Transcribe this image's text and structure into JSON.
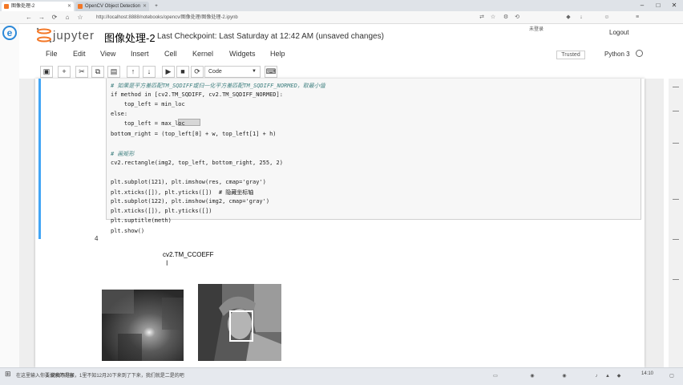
{
  "browser": {
    "tabs": [
      {
        "label": "图像处理-2",
        "active": true
      },
      {
        "label": "OpenCV Object Detection",
        "active": false
      }
    ],
    "url": "http://localhost:8888/notebooks/opencv/图像处理/图像处理-2.ipynb",
    "profile_label": "未登录"
  },
  "jupyter": {
    "logo_text": "jupyter",
    "notebook_title": "图像处理-2",
    "checkpoint": "Last Checkpoint: Last Saturday at 12:42 AM (unsaved changes)",
    "logout": "Logout",
    "menus": [
      "File",
      "Edit",
      "View",
      "Insert",
      "Cell",
      "Kernel",
      "Widgets",
      "Help"
    ],
    "trusted": "Trusted",
    "kernel": "Python 3",
    "cell_type": "Code",
    "toolbar_icons": [
      "save-icon",
      "add-icon",
      "cut-icon",
      "copy-icon",
      "paste-icon",
      "move-up-icon",
      "move-down-icon",
      "run-icon",
      "stop-icon",
      "restart-icon",
      "keyboard-icon"
    ]
  },
  "cell": {
    "code_lines": [
      {
        "text": "# 如果是平方差匹配TM_SQDIFF或归一化平方差匹配TM_SQDIFF_NORMED，取最小值",
        "comment": true
      },
      {
        "text": "if method in [cv2.TM_SQDIFF, cv2.TM_SQDIFF_NORMED]:",
        "comment": false
      },
      {
        "text": "    top_left = min_loc",
        "comment": false
      },
      {
        "text": "else:",
        "comment": false
      },
      {
        "text": "    top_left = max_loc",
        "comment": false
      },
      {
        "text": "bottom_right = (top_left[0] + w, top_left[1] + h)",
        "comment": false
      },
      {
        "text": "",
        "comment": false
      },
      {
        "text": "# 画矩形",
        "comment": true
      },
      {
        "text": "cv2.rectangle(img2, top_left, bottom_right, 255, 2)",
        "comment": false
      },
      {
        "text": "",
        "comment": false
      },
      {
        "text": "plt.subplot(121), plt.imshow(res, cmap='gray')",
        "comment": false
      },
      {
        "text": "plt.xticks([]), plt.yticks([])  # 隐藏坐标轴",
        "comment": false
      },
      {
        "text": "plt.subplot(122), plt.imshow(img2, cmap='gray')",
        "comment": false
      },
      {
        "text": "plt.xticks([]), plt.yticks([])",
        "comment": false
      },
      {
        "text": "plt.suptitle(meth)",
        "comment": false
      },
      {
        "text": "plt.show()",
        "comment": false
      }
    ],
    "output_prompt": "4",
    "output_text": "cv2.TM_CCOEFF",
    "cursor": "I"
  },
  "taskbar": {
    "search_hint": "在这里输入你要搜索的内容",
    "notification": "1.说我不是很，1里不知12月20下来到了下来，我们就是二是的吧",
    "tray_items": [
      "任务视图",
      "声音",
      "网络"
    ],
    "clock": "14:10"
  },
  "colors": {
    "accent": "#42a5f5",
    "jupyter_orange": "#f37726"
  }
}
